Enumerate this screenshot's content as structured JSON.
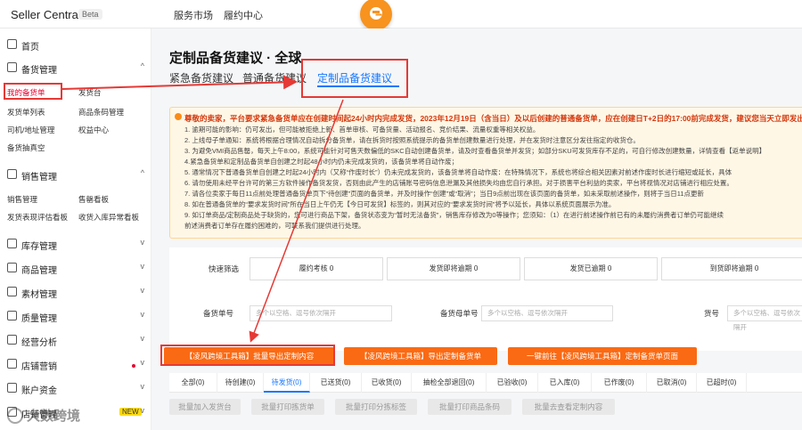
{
  "header": {
    "brand": "Seller Central",
    "beta": "Beta",
    "nav": [
      "服务市场",
      "履约中心"
    ]
  },
  "sidebar": {
    "home": "首页",
    "sections": [
      {
        "label": "备货管理",
        "chev": "^"
      },
      {
        "label": "销售管理",
        "chev": "^"
      },
      {
        "label": "库存管理",
        "chev": "v"
      },
      {
        "label": "商品管理",
        "chev": "v"
      },
      {
        "label": "素材管理",
        "chev": "v"
      },
      {
        "label": "质量管理",
        "chev": "v"
      },
      {
        "label": "经营分析",
        "chev": "v"
      },
      {
        "label": "店铺营销",
        "chev": "v"
      },
      {
        "label": "账户资金",
        "chev": "v"
      },
      {
        "label": "店铺管理",
        "chev": "v",
        "badge": "NEW"
      }
    ],
    "stock_subs": [
      "我的备货单",
      "发货台",
      "发货单列表",
      "商品条码管理",
      "司机/地址管理",
      "权益中心",
      "备货抽真空"
    ],
    "sales_subs": [
      "销售管理",
      "售罄看板",
      "发货表现评估看板",
      "收货入库异常看板"
    ]
  },
  "main": {
    "title": "定制品备货建议 · 全球",
    "tabs": [
      "紧急备货建议",
      "普通备货建议",
      "定制品备货建议"
    ],
    "notice": {
      "head": "尊敬的卖家，平台要求紧急备货单应在创建时间起24小时内完成发货，2023年12月19日（含当日）及以后创建的普通备货单，应在创建日T+2日的17:00前完成发货，建议您当天立即发出。",
      "lines": [
        "1. 逾期可能的影响：仍可发出，但可能被拒绝上新、首单审核、可备货量、活动报名、竞价结果、流量权重等相关权益。",
        "2. 上线母子单通知：系统将根据合理情况自动拆分备货单，请在拆货时按照系统提示的备货单创建数量进行处理，并在发货时注意区分发往指定的收货仓。",
        "3. 为避免VMI商品售罄，每天上午8:00，系统可能针对可售天数偏低的SKC自动创建备货单，请及时查看备货单并发货；如部分SKU可发货库存不足的，可自行修改创建数量，详情查看【返单说明】",
        "4.紧急备货单和定制品备货单自创建之时起48小时内仍未完成发货的，该备货单将自动作废；",
        "5. 通常情况下普通备货单自创建之时起24小时内（又称“作废时长”）仍未完成发货的，该备货单将自动作废：在特殊情况下，系统也将综合相关因素对前述作废时长进行缩短或延长，具体",
        "6. 请勿使用未经平台许可的第三方软件操作备货发货，否则由此产生的店铺账号密码信息泄漏及其他损失均由您自行承担。对于损害平台利益的卖家，平台将视情况对店铺进行相应处置。",
        "7. 请各位卖家于每日11点前处理普通备货单页下“待创建”页面的备货单，并及时操作“创建”或“取消”；当日9点前出现在该页面的备货单，如未采取前述操作，则将于当日11点更新",
        "8. 如在普通备货单的“要求发货时间”所在当日上午仍无【今日可发货】标签的，则其对应的“要求发货时间”将予以延长，具体以系统页面展示为准。",
        "9. 如订单商品/定制商品处于缺货的，您可进行商品下架，备货状态变为“暂时无法备货”，销售库存修改为0等操作；您须知：（1）在进行前述操作前已有的未履约消费者订单仍可能继续",
        "前述消费者订单存在履约困难的，可联系我们提供进行处理。"
      ]
    },
    "filters": {
      "quick": "快速筛选",
      "boxes": [
        "履约考核 0",
        "发货即将逾期 0",
        "发货已逾期 0",
        "到货即将逾期 0"
      ],
      "order_label": "备货单号",
      "order_ph": "多个以空格、逗号依次隔开",
      "parent_label": "备货母单号",
      "parent_ph": "多个以空格、逗号依次隔开",
      "sku_label": "货号",
      "sku_ph": "多个以空格、逗号依次隔开"
    },
    "actions": [
      "【凌风跨境工具箱】批量导出定制内容",
      "【凌风跨境工具箱】导出定制备货单",
      "一键前往【凌风跨境工具箱】定制备货单页面"
    ],
    "status_tabs": [
      "全部(0)",
      "待创建(0)",
      "待发货(0)",
      "已送货(0)",
      "已收货(0)",
      "抽检全部退回(0)",
      "已验收(0)",
      "已入库(0)",
      "已作废(0)",
      "已取消(0)",
      "已超时(0)"
    ],
    "bulk": [
      "批量加入发货台",
      "批量打印拣货单",
      "批量打印分拣标签",
      "批量打印商品条码",
      "批量去查看定制内容"
    ]
  },
  "watermark": "大数跨境",
  "colors": {
    "accent": "#1677ff",
    "annotation": "#e53935",
    "action": "#fa6a14"
  }
}
